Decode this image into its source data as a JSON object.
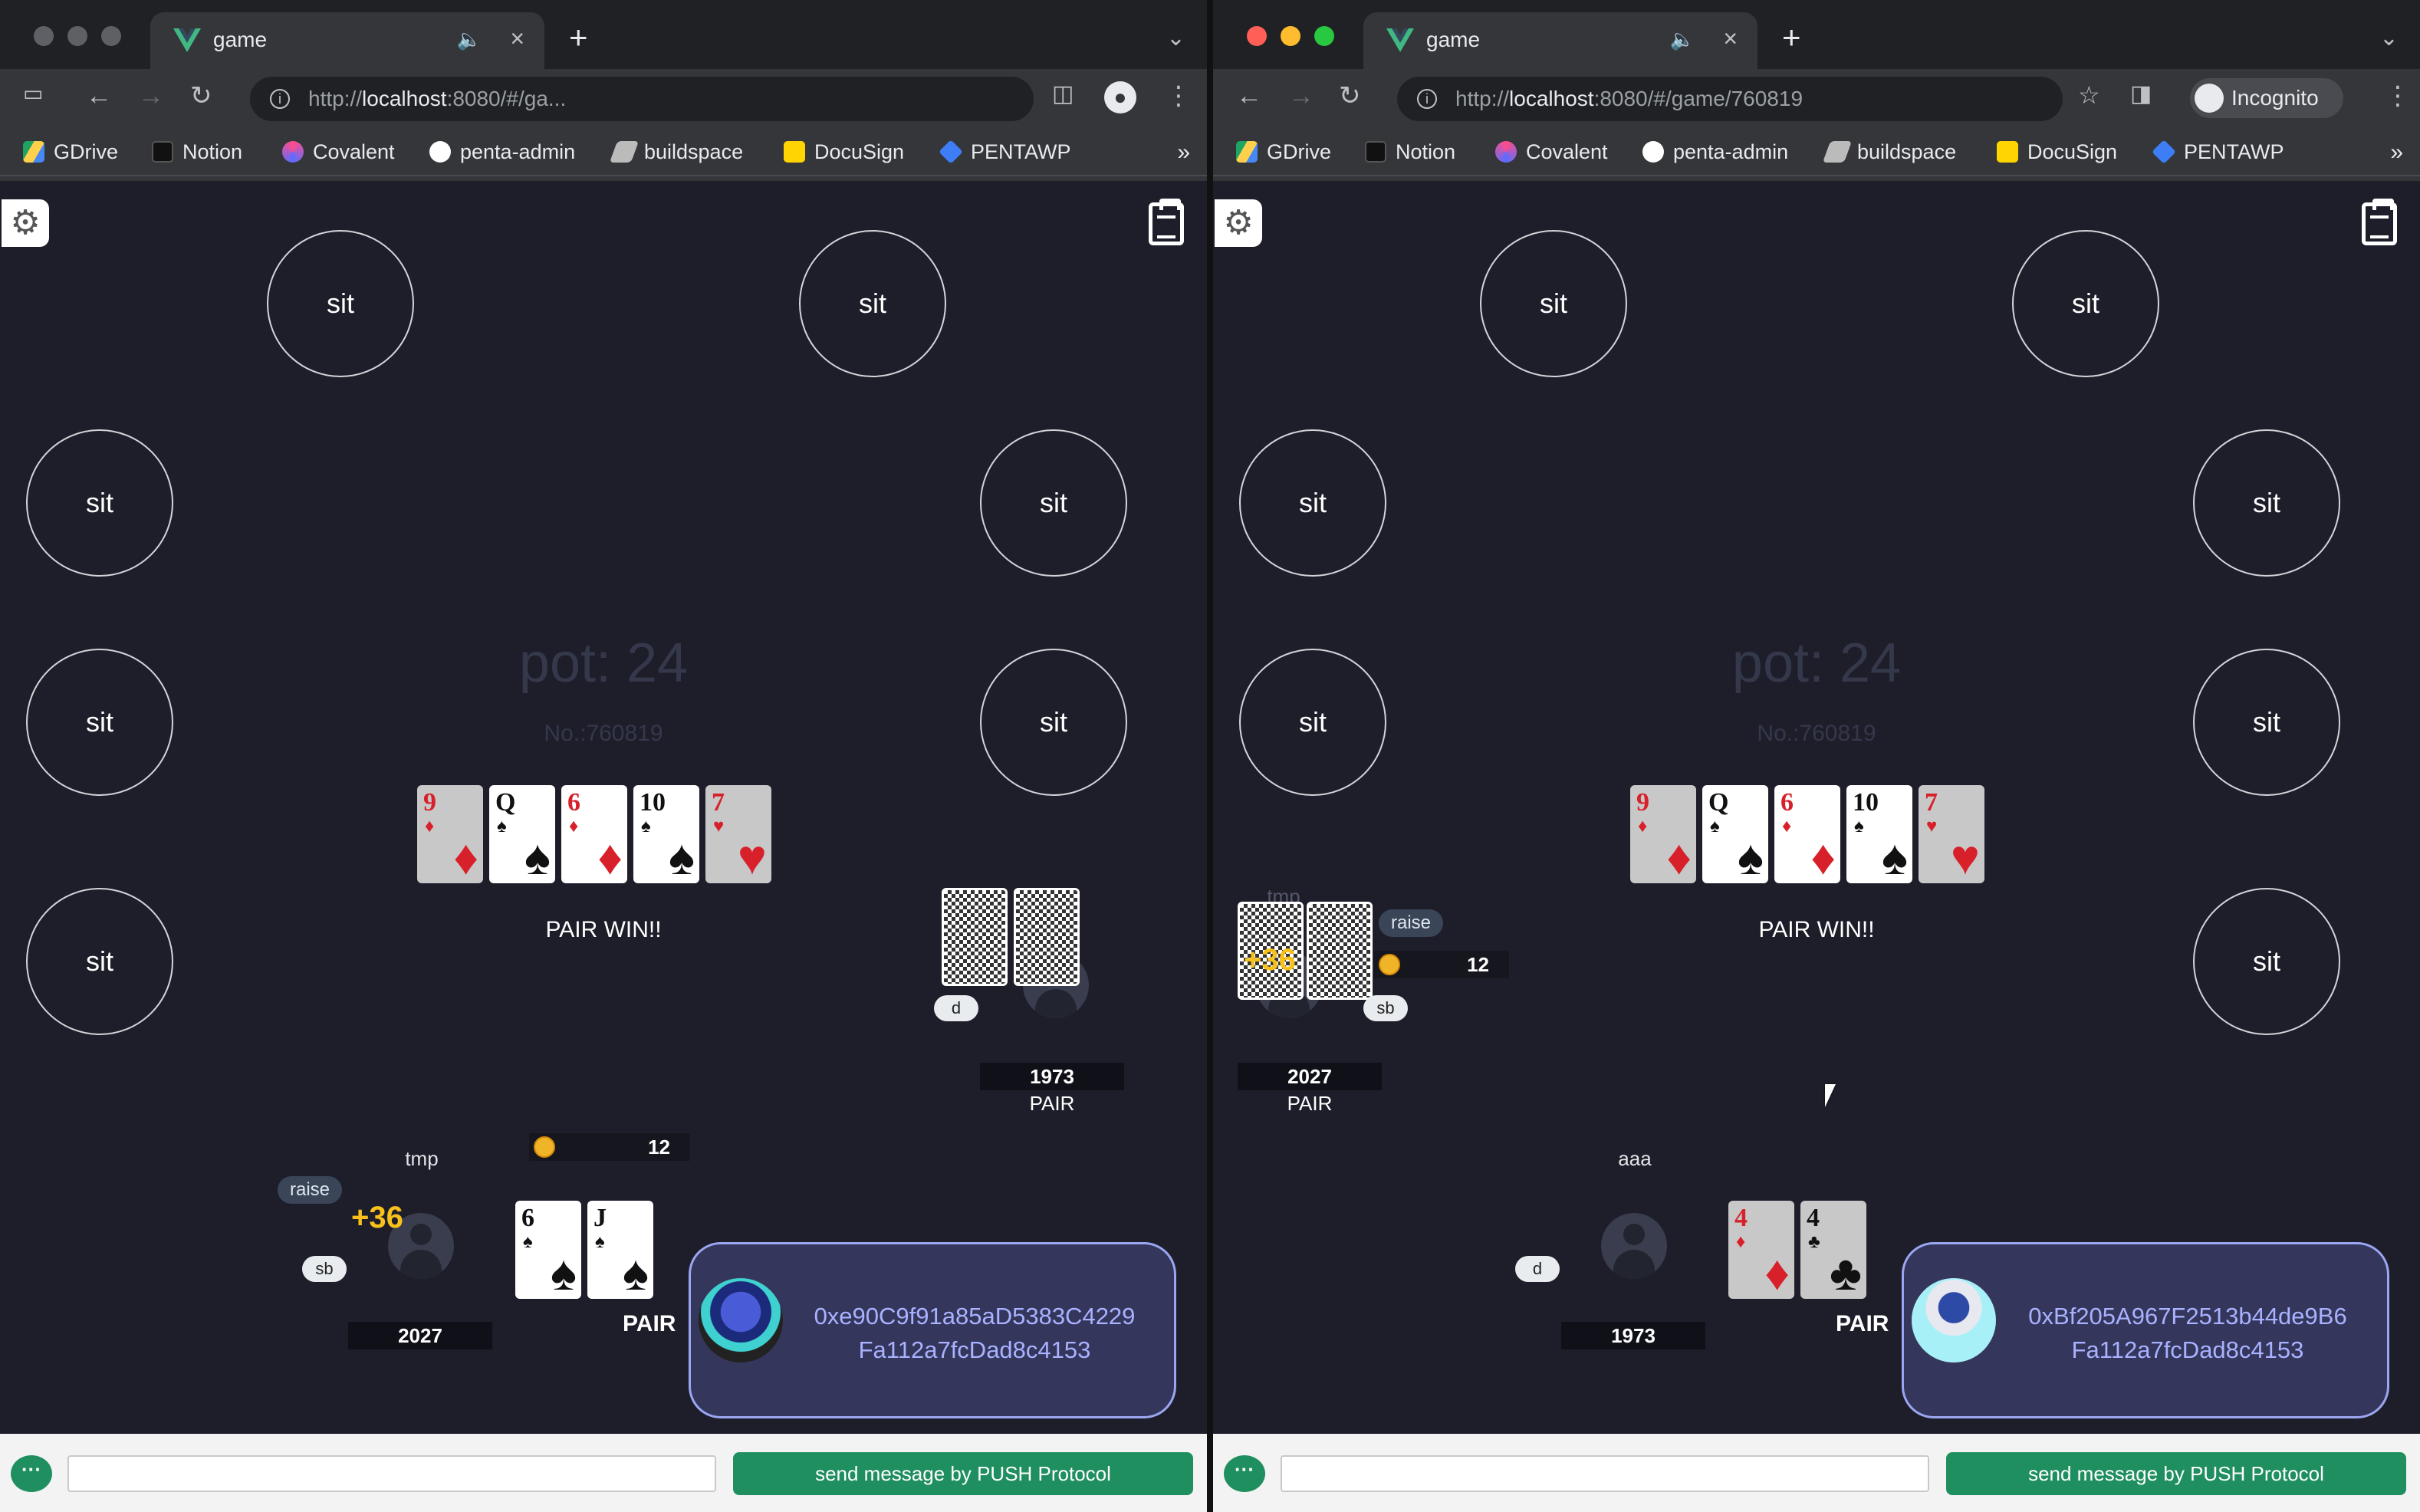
{
  "left": {
    "tab_title": "game",
    "url_prefix": "http://",
    "url_host": "localhost",
    "url_rest": ":8080/#/ga...",
    "bookmarks": [
      "GDrive",
      "Notion",
      "Covalent",
      "penta-admin",
      "buildspace",
      "DocuSign",
      "PENTAWP"
    ],
    "seat_label": "sit",
    "pot": "pot: 24",
    "game_no": "No.:760819",
    "result": "PAIR WIN!!",
    "opponent": {
      "dealer": "d",
      "stack": "1973",
      "hand": "PAIR"
    },
    "me": {
      "name": "tmp",
      "action": "raise",
      "gain": "+36",
      "blind": "sb",
      "stack": "2027",
      "bet": "12",
      "hand": "PAIR",
      "cards": [
        {
          "rank": "6",
          "suit": "♠",
          "color": "blk"
        },
        {
          "rank": "J",
          "suit": "♠",
          "color": "blk"
        }
      ]
    },
    "wallet": {
      "line1": "0xe90C9f91a85aD5383C4229",
      "line2": "Fa112a7fcDad8c4153"
    },
    "send_label": "send message by PUSH Protocol"
  },
  "right": {
    "tab_title": "game",
    "url_prefix": "http://",
    "url_host": "localhost",
    "url_rest": ":8080/#/game/760819",
    "incognito": "Incognito",
    "bookmarks": [
      "GDrive",
      "Notion",
      "Covalent",
      "penta-admin",
      "buildspace",
      "DocuSign",
      "PENTAWP"
    ],
    "seat_label": "sit",
    "pot": "pot: 24",
    "game_no": "No.:760819",
    "result": "PAIR WIN!!",
    "opponent": {
      "name": "tmp",
      "action": "raise",
      "gain": "+36",
      "blind": "sb",
      "stack": "2027",
      "bet": "12",
      "hand": "PAIR"
    },
    "me": {
      "name": "aaa",
      "dealer": "d",
      "stack": "1973",
      "hand": "PAIR",
      "cards": [
        {
          "rank": "4",
          "suit": "♦",
          "color": "red"
        },
        {
          "rank": "4",
          "suit": "♣",
          "color": "blk"
        }
      ]
    },
    "wallet": {
      "line1": "0xBf205A967F2513b44de9B6",
      "line2": "Fa112a7fcDad8c4153"
    },
    "send_label": "send message by PUSH Protocol"
  },
  "community_cards": [
    {
      "rank": "9",
      "suit": "♦",
      "color": "red"
    },
    {
      "rank": "Q",
      "suit": "♠",
      "color": "blk"
    },
    {
      "rank": "6",
      "suit": "♦",
      "color": "red"
    },
    {
      "rank": "10",
      "suit": "♠",
      "color": "blk"
    },
    {
      "rank": "7",
      "suit": "♥",
      "color": "red"
    }
  ],
  "colors": {
    "table_bg": "#1e1e2b",
    "accent_green": "#1f8f5f",
    "chip_gold": "#f0b429",
    "wallet_border": "#9aa6f0"
  }
}
